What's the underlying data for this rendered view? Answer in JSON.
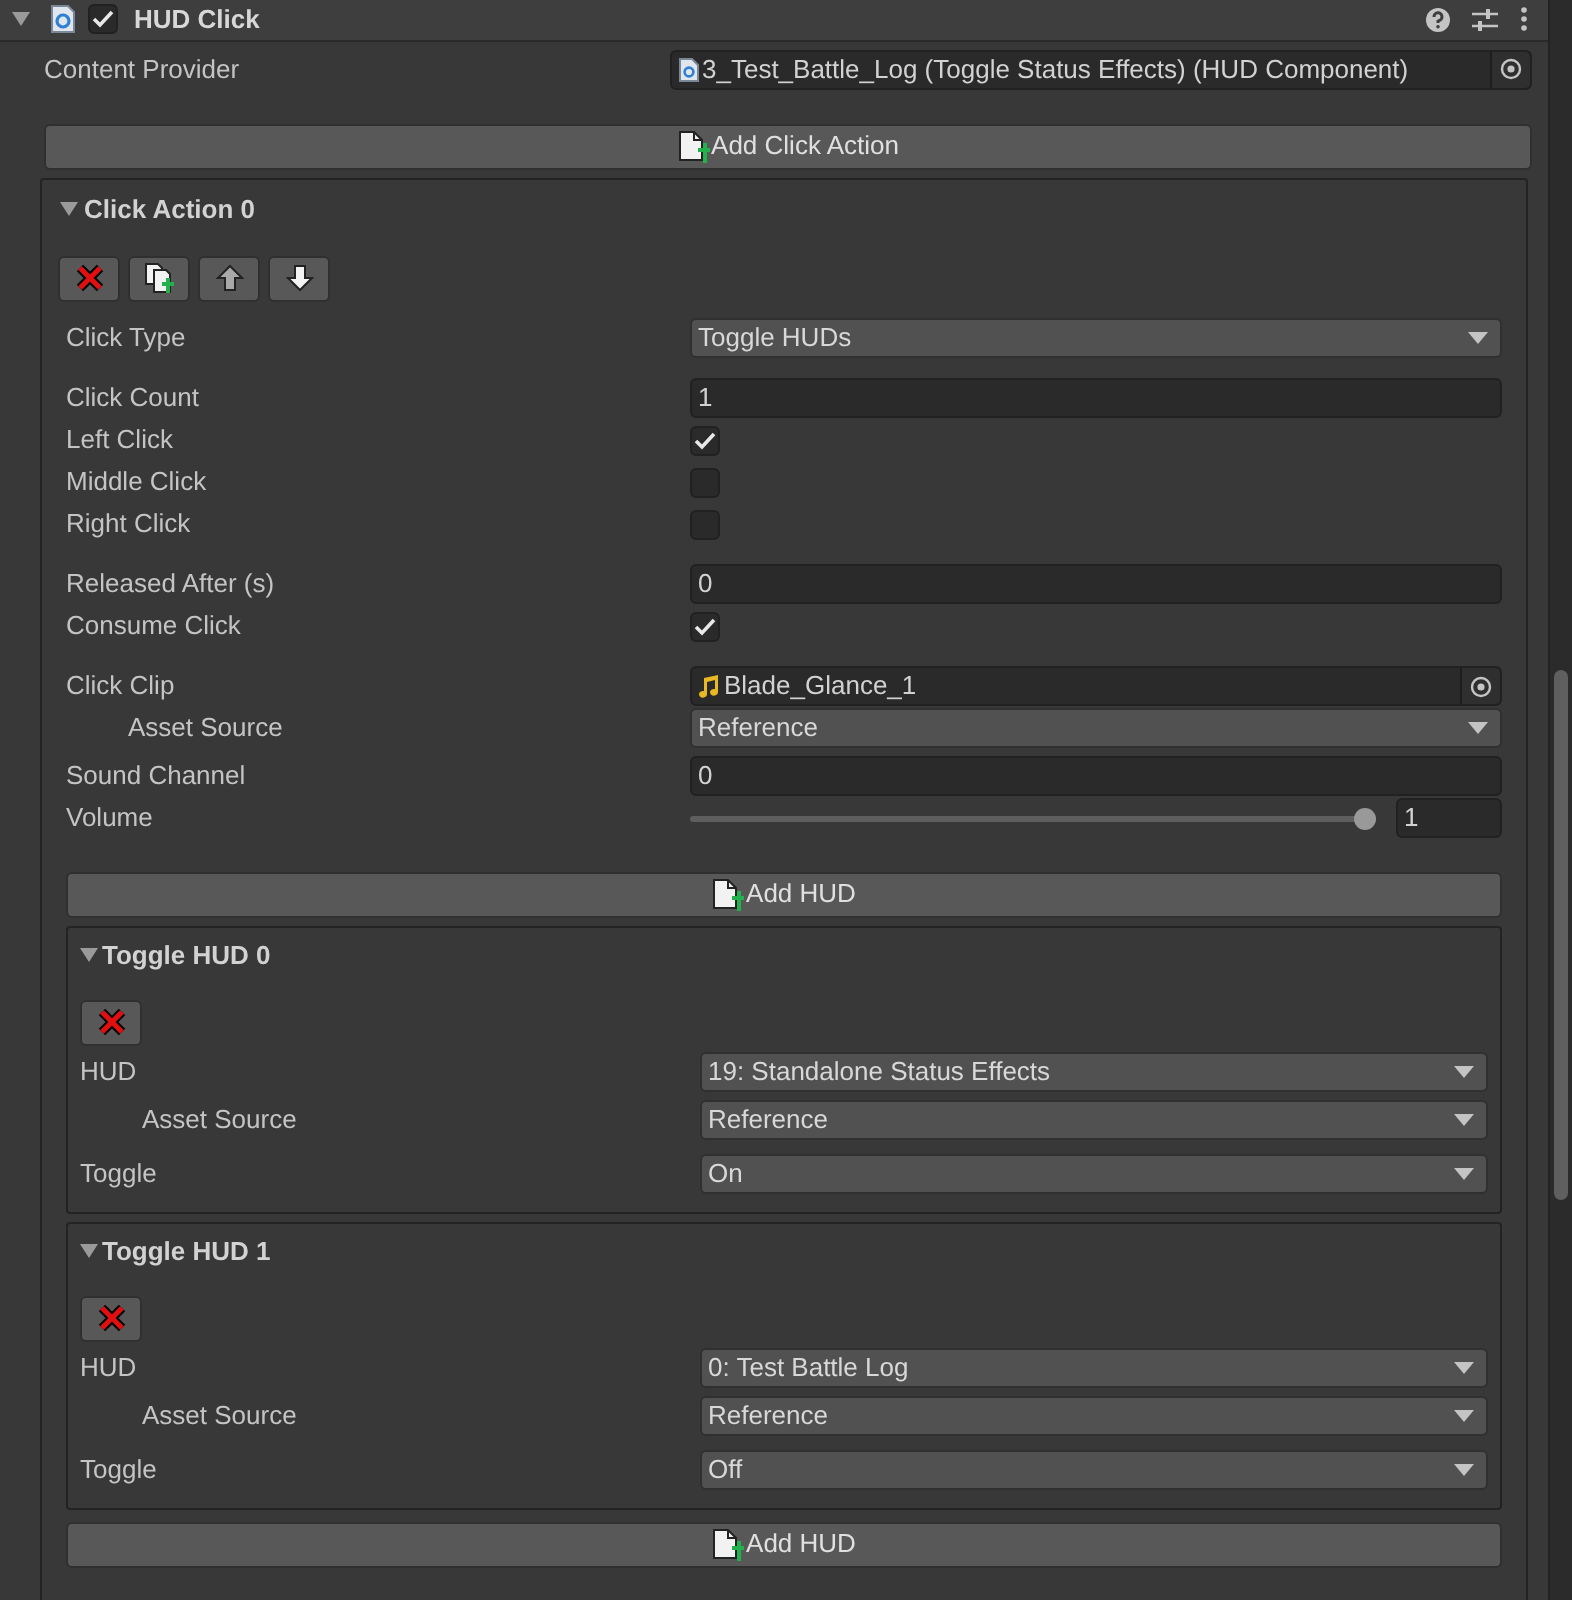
{
  "component": {
    "title": "HUD Click",
    "enabled": true,
    "expanded": true
  },
  "content_provider": {
    "label": "Content Provider",
    "value": "3_Test_Battle_Log (Toggle Status Effects) (HUD Component)"
  },
  "add_click_action_button": "Add Click Action",
  "click_actions": [
    {
      "title": "Click Action 0",
      "expanded": true,
      "field_groups": [
        [
          {
            "kind": "dropdown",
            "label": "Click Type",
            "value": "Toggle HUDs"
          }
        ],
        [
          {
            "kind": "text",
            "label": "Click Count",
            "value": "1"
          },
          {
            "kind": "checkbox",
            "label": "Left Click",
            "checked": true
          },
          {
            "kind": "checkbox",
            "label": "Middle Click",
            "checked": false
          },
          {
            "kind": "checkbox",
            "label": "Right Click",
            "checked": false
          }
        ],
        [
          {
            "kind": "text",
            "label": "Released After (s)",
            "value": "0"
          },
          {
            "kind": "checkbox",
            "label": "Consume Click",
            "checked": true
          }
        ],
        [
          {
            "kind": "object",
            "label": "Click Clip",
            "value": "Blade_Glance_1"
          },
          {
            "kind": "dropdown",
            "label": "Asset Source",
            "value": "Reference",
            "indented": true
          },
          {
            "kind": "text",
            "label": "Sound Channel",
            "value": "0"
          },
          {
            "kind": "slider",
            "label": "Volume",
            "level": 1,
            "value": "1"
          }
        ]
      ],
      "add_hud_button": "Add HUD",
      "toggle_huds": [
        {
          "title": "Toggle HUD 0",
          "expanded": true,
          "fields": [
            {
              "kind": "dropdown",
              "label": "HUD",
              "value": "19: Standalone Status Effects"
            },
            {
              "kind": "dropdown",
              "label": "Asset Source",
              "value": "Reference",
              "indented": true
            },
            {
              "kind": "dropdown",
              "label": "Toggle",
              "value": "On"
            }
          ]
        },
        {
          "title": "Toggle HUD 1",
          "expanded": true,
          "fields": [
            {
              "kind": "dropdown",
              "label": "HUD",
              "value": "0: Test Battle Log"
            },
            {
              "kind": "dropdown",
              "label": "Asset Source",
              "value": "Reference",
              "indented": true
            },
            {
              "kind": "dropdown",
              "label": "Toggle",
              "value": "Off"
            }
          ]
        }
      ],
      "add_hud_button_bottom": "Add HUD"
    }
  ]
}
